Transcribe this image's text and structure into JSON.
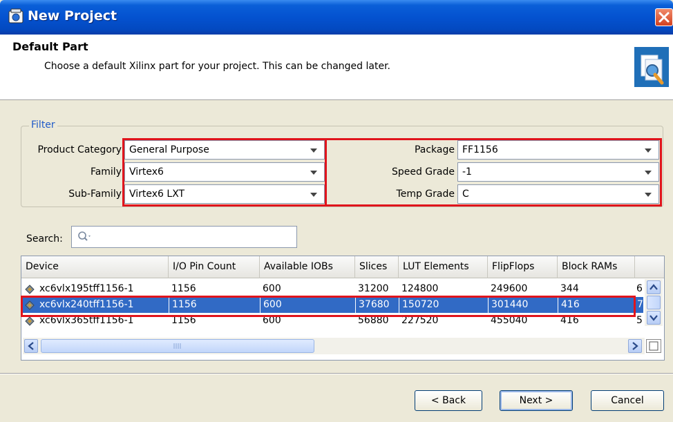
{
  "window": {
    "title": "New Project"
  },
  "header": {
    "title": "Default Part",
    "description": "Choose a default Xilinx part for your project. This can be changed later."
  },
  "filter": {
    "legend": "Filter",
    "product_category": {
      "label": "Product Category",
      "value": "General Purpose"
    },
    "family": {
      "label": "Family",
      "value": "Virtex6"
    },
    "sub_family": {
      "label": "Sub-Family",
      "value": "Virtex6 LXT"
    },
    "package": {
      "label": "Package",
      "value": "FF1156"
    },
    "speed_grade": {
      "label": "Speed Grade",
      "value": "-1"
    },
    "temp_grade": {
      "label": "Temp Grade",
      "value": "C"
    }
  },
  "search": {
    "label": "Search:",
    "value": ""
  },
  "table": {
    "columns": [
      "Device",
      "I/O Pin Count",
      "Available IOBs",
      "Slices",
      "LUT Elements",
      "FlipFlops",
      "Block RAMs"
    ],
    "rows": [
      {
        "device": "xc6vlx195tff1156-1",
        "io_pin_count": "1156",
        "available_iobs": "600",
        "slices": "31200",
        "lut_elements": "124800",
        "flipflops": "249600",
        "block_rams": "344",
        "overflow": "6"
      },
      {
        "device": "xc6vlx240tff1156-1",
        "io_pin_count": "1156",
        "available_iobs": "600",
        "slices": "37680",
        "lut_elements": "150720",
        "flipflops": "301440",
        "block_rams": "416",
        "overflow": "7"
      },
      {
        "device": "xc6vlx365tff1156-1",
        "io_pin_count": "1156",
        "available_iobs": "600",
        "slices": "56880",
        "lut_elements": "227520",
        "flipflops": "455040",
        "block_rams": "416",
        "overflow": "5"
      }
    ],
    "selected_row": 1
  },
  "buttons": {
    "back": "< Back",
    "next": "Next >",
    "cancel": "Cancel"
  },
  "colors": {
    "highlight": "#e0141c",
    "selection": "#316ac5",
    "titlebar": "#0452d0"
  }
}
